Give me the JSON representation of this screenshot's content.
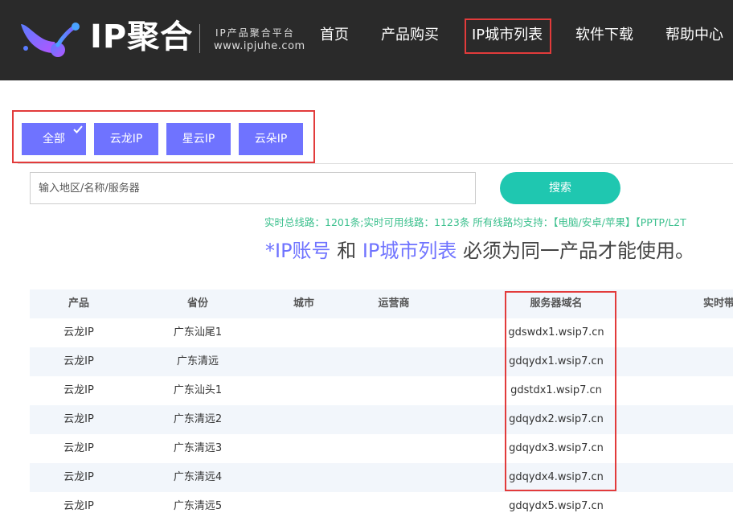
{
  "header": {
    "brand": "IP聚合",
    "tagline": "IP产品聚合平台",
    "domain": "www.ipjuhe.com",
    "nav": [
      {
        "label": "首页"
      },
      {
        "label": "产品购买"
      },
      {
        "label": "IP城市列表",
        "active": true
      },
      {
        "label": "软件下载"
      },
      {
        "label": "帮助中心"
      }
    ]
  },
  "filters": {
    "tabs": [
      {
        "label": "全部",
        "selected": true
      },
      {
        "label": "云龙IP"
      },
      {
        "label": "星云IP"
      },
      {
        "label": "云朵IP"
      }
    ]
  },
  "search": {
    "placeholder": "输入地区/名称/服务器",
    "value": "",
    "button_label": "搜索"
  },
  "stats": "实时总线路：1201条;实时可用线路：1123条 所有线路均支持：【电脑/安卓/苹果】【PPTP/L2T",
  "notice": {
    "prefix": "*IP账号",
    "middle": " 和 ",
    "link": "IP城市列表",
    "suffix": " 必须为同一产品才能使用。"
  },
  "table": {
    "columns": [
      "产品",
      "省份",
      "城市",
      "运营商",
      "服务器域名",
      "实时带"
    ],
    "rows": [
      {
        "product": "云龙IP",
        "province": "广东汕尾1",
        "city": "",
        "isp": "",
        "domain": "gdswdx1.wsip7.cn"
      },
      {
        "product": "云龙IP",
        "province": "广东清远",
        "city": "",
        "isp": "",
        "domain": "gdqydx1.wsip7.cn"
      },
      {
        "product": "云龙IP",
        "province": "广东汕头1",
        "city": "",
        "isp": "",
        "domain": "gdstdx1.wsip7.cn"
      },
      {
        "product": "云龙IP",
        "province": "广东清远2",
        "city": "",
        "isp": "",
        "domain": "gdqydx2.wsip7.cn"
      },
      {
        "product": "云龙IP",
        "province": "广东清远3",
        "city": "",
        "isp": "",
        "domain": "gdqydx3.wsip7.cn"
      },
      {
        "product": "云龙IP",
        "province": "广东清远4",
        "city": "",
        "isp": "",
        "domain": "gdqydx4.wsip7.cn"
      },
      {
        "product": "云龙IP",
        "province": "广东清远5",
        "city": "",
        "isp": "",
        "domain": "gdqydx5.wsip7.cn"
      }
    ]
  },
  "colors": {
    "header_bg": "#2a2a2a",
    "accent": "#6f73ff",
    "search_button": "#1fc7b0",
    "stats_text": "#3cc08e",
    "highlight_box": "#e23b3b"
  }
}
